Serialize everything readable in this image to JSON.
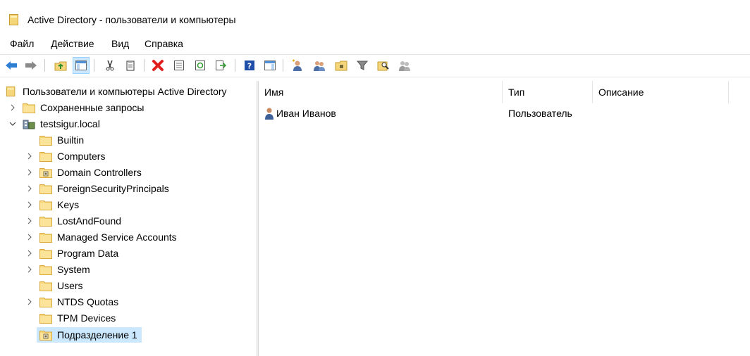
{
  "window": {
    "title": "Active Directory - пользователи и компьютеры"
  },
  "menu": [
    "Файл",
    "Действие",
    "Вид",
    "Справка"
  ],
  "toolbar": {
    "buttons": [
      "back-icon",
      "forward-icon",
      "up-folder-icon",
      "show-hide-console-tree-icon",
      "cut-icon",
      "copy-icon",
      "delete-icon",
      "properties-icon",
      "refresh-icon",
      "export-list-icon",
      "help-icon",
      "show-action-pane-icon",
      "new-user-icon",
      "new-group-icon",
      "new-ou-icon",
      "filter-icon",
      "find-icon",
      "add-to-group-icon"
    ]
  },
  "tree": {
    "root": "Пользователи и компьютеры Active Directory",
    "saved_queries": "Сохраненные запросы",
    "domain": "testsigur.local",
    "children": [
      {
        "label": "Builtin",
        "expandable": false
      },
      {
        "label": "Computers",
        "expandable": true
      },
      {
        "label": "Domain Controllers",
        "expandable": true,
        "ou": true
      },
      {
        "label": "ForeignSecurityPrincipals",
        "expandable": true
      },
      {
        "label": "Keys",
        "expandable": true
      },
      {
        "label": "LostAndFound",
        "expandable": true
      },
      {
        "label": "Managed Service Accounts",
        "expandable": true
      },
      {
        "label": "Program Data",
        "expandable": true
      },
      {
        "label": "System",
        "expandable": true
      },
      {
        "label": "Users",
        "expandable": false
      },
      {
        "label": "NTDS Quotas",
        "expandable": true
      },
      {
        "label": "TPM Devices",
        "expandable": false
      },
      {
        "label": "Подразделение 1",
        "expandable": false,
        "ou": true,
        "selected": true
      }
    ]
  },
  "list": {
    "columns": [
      "Имя",
      "Тип",
      "Описание"
    ],
    "rows": [
      {
        "name": "Иван Иванов",
        "type": "Пользователь",
        "description": ""
      }
    ]
  },
  "colors": {
    "selection": "#cce8ff",
    "folder": "#f6d67a",
    "folder_dark": "#d9a93b"
  }
}
